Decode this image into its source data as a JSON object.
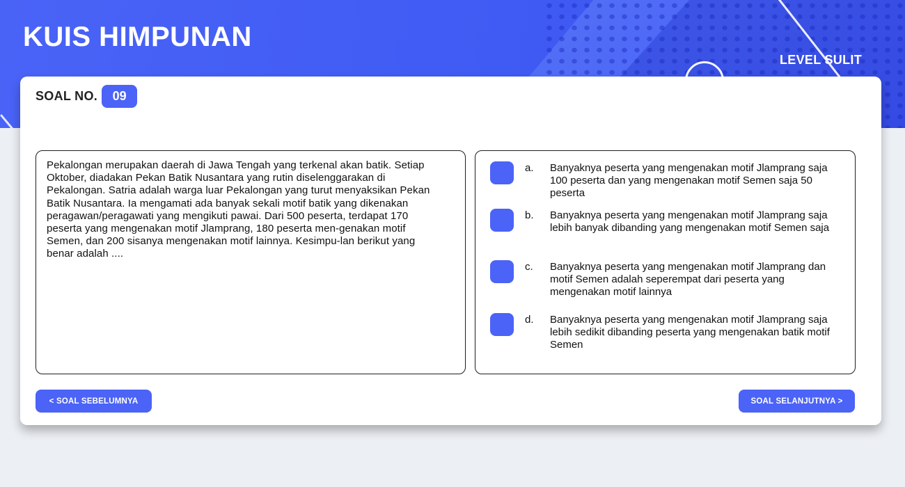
{
  "header": {
    "title": "KUIS HIMPUNAN",
    "level": "LEVEL SULIT"
  },
  "question": {
    "label": "SOAL NO.",
    "number": "09",
    "text": "Pekalongan merupakan daerah di Jawa Tengah yang terkenal akan batik. Setiap Oktober, diadakan Pekan Batik Nusantara yang rutin diselenggarakan di Pekalongan. Satria adalah warga luar Pekalongan yang turut menyaksikan Pekan Batik Nusantara. Ia mengamati ada banyak sekali motif batik yang dikenakan peragawan/peragawati yang mengikuti pawai. Dari 500 peserta, terdapat 170 peserta yang mengenakan motif Jlamprang, 180 peserta men-genakan motif Semen, dan 200 sisanya mengenakan motif lainnya. Kesimpu-lan berikut yang benar adalah ...."
  },
  "options": [
    {
      "letter": "a.",
      "text": "Banyaknya peserta yang mengenakan motif Jlamprang saja 100 peserta dan yang mengenakan motif Semen saja 50 peserta"
    },
    {
      "letter": "b.",
      "text": "Banyaknya peserta yang mengenakan motif Jlamprang saja lebih banyak dibanding yang mengenakan motif Semen saja"
    },
    {
      "letter": "c.",
      "text": "Banyaknya peserta yang mengenakan motif Jlamprang dan motif Semen adalah seperempat dari peserta yang mengenakan motif lainnya"
    },
    {
      "letter": "d.",
      "text": "Banyaknya peserta yang mengenakan motif Jlamprang saja lebih sedikit dibanding peserta yang mengenakan batik motif Semen"
    }
  ],
  "nav": {
    "prev_label": "< SOAL SEBELUMNYA",
    "next_label": "SOAL SELANJUTNYA >"
  },
  "colors": {
    "accent": "#4b63f6",
    "header_bg": "#4059f4",
    "page_bg": "#eceff4"
  }
}
